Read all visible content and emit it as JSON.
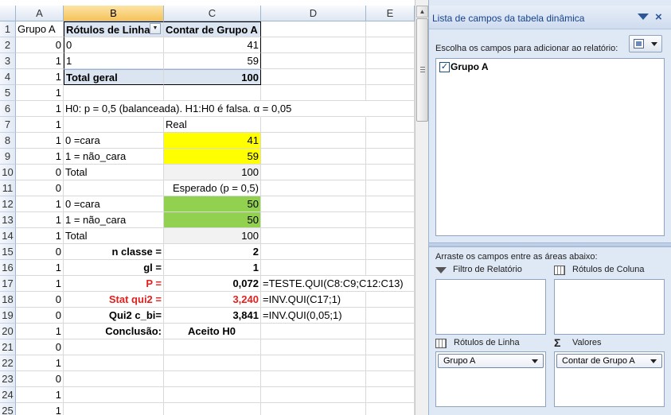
{
  "sheet": {
    "columns": [
      "A",
      "B",
      "C",
      "D",
      "E"
    ],
    "rows": [
      "1",
      "2",
      "3",
      "4",
      "5",
      "6",
      "7",
      "8",
      "9",
      "10",
      "11",
      "12",
      "13",
      "14",
      "15",
      "16",
      "17",
      "18",
      "19",
      "20",
      "21",
      "22",
      "23",
      "24",
      "25"
    ],
    "colA": [
      "Grupo A",
      "0",
      "1",
      "1",
      "1",
      "1",
      "1",
      "1",
      "1",
      "0",
      "0",
      "1",
      "1",
      "1",
      "0",
      "1",
      "1",
      "0",
      "0",
      "1",
      "0",
      "1",
      "0",
      "1",
      "1"
    ],
    "pivot": {
      "row_labels": "Rótulos de Linha",
      "count_header": "Contar de Grupo A",
      "r2_label": "0",
      "r2_value": "41",
      "r3_label": "1",
      "r3_value": "59",
      "total_label": "Total geral",
      "total_value": "100"
    },
    "hypothesis": "H0: p = 0,5 (balanceada). H1:H0 é falsa. α = 0,05",
    "real_header": "Real",
    "r8_label": "0 =cara",
    "r8_value": "41",
    "r9_label": "1 = não_cara",
    "r9_value": "59",
    "r10_label": "Total",
    "r10_value": "100",
    "expected_header": "Esperado (p = 0,5)",
    "r12_label": "0 =cara",
    "r12_value": "50",
    "r13_label": "1 = não_cara",
    "r13_value": "50",
    "r14_label": "Total",
    "r14_value": "100",
    "r15_label": "n classe =",
    "r15_value": "2",
    "r16_label": "gl =",
    "r16_value": "1",
    "r17_label": "P =",
    "r17_value": "0,072",
    "r17_formula": "=TESTE.QUI(C8:C9;C12:C13)",
    "r18_label": "Stat qui2 =",
    "r18_value": "3,240",
    "r18_formula": "=INV.QUI(C17;1)",
    "r19_label": "Qui2 c_bi=",
    "r19_value": "3,841",
    "r19_formula": "=INV.QUI(0,05;1)",
    "r20_label": "Conclusão:",
    "r20_value": "Aceito H0"
  },
  "pane": {
    "title": "Lista de campos da tabela dinâmica",
    "choose_label": "Escolha os campos para adicionar ao relatório:",
    "fields": [
      {
        "name": "Grupo A",
        "checked": "✓"
      }
    ],
    "drag_label": "Arraste os campos entre as áreas abaixo:",
    "areas": {
      "report_filter": "Filtro de Relatório",
      "column_labels": "Rótulos de Coluna",
      "row_labels": "Rótulos de Linha",
      "values": "Valores",
      "sigma": "Σ",
      "row_chip": "Grupo A",
      "value_chip": "Contar de Grupo A"
    }
  },
  "colors": {
    "yellow": "#ffff00",
    "green": "#92d050",
    "red_text": "#e0211f",
    "pivot_header": "#dbe5f1",
    "pane_bg": "#dfe8f5"
  }
}
